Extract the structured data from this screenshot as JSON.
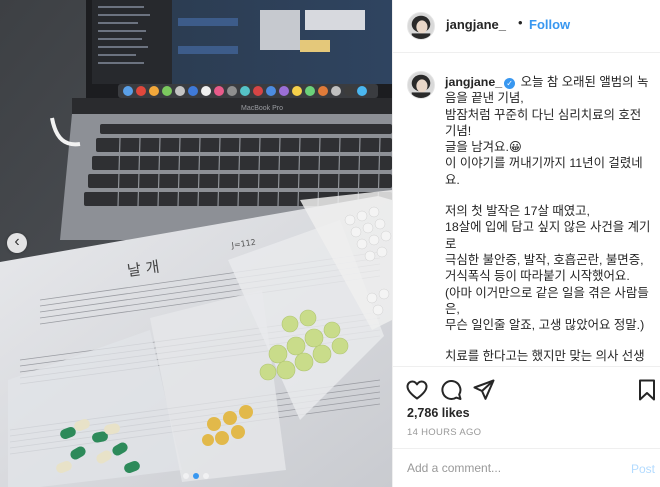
{
  "post": {
    "username": "jangjane_",
    "follow_label": "Follow",
    "separator": "•",
    "verified_icon": "✓"
  },
  "caption": {
    "username": "jangjane_",
    "paragraphs": [
      "오늘 참 오래된 앨범의 녹음을 끝낸 기념,\n밤잠처럼 꾸준히 다닌 심리치료의 호전 기념!\n글을 남겨요.😀\n이 이야기를 꺼내기까지 11년이 걸렸네요.",
      "저의 첫 발작은 17살 때였고,\n18살에 입에 담고 싶지 않은 사건을 계기로\n극심한 불안증, 발작, 호흡곤란, 불면증, 거식폭식 등이 따라붙기 시작했어요.\n(아마 이거만으로 같은 일을 겪은 사람들은,\n무슨 일인줄 알죠, 고생 많았어요 정말.)",
      "치료를 한다고는 했지만 맞는 의사 선생님 찾는 것도 쉬운 일이 아니었고\n그 때 당시엔 병원 가는 걸 큰 흠으로 여"
    ]
  },
  "engagement": {
    "likes": "2,786 likes",
    "timestamp": "14 HOURS AGO"
  },
  "comment_box": {
    "placeholder": "Add a comment...",
    "post_label": "Post"
  },
  "photo": {
    "macbook_label": "MacBook Pro",
    "sheet_title": "날 개",
    "sheet_corner": "J=112",
    "carousel_prev": "‹",
    "carousel_total": 3,
    "carousel_active": 1
  },
  "colors": {
    "link_blue": "#3897f0",
    "post_disabled": "#b3dbff",
    "meta_gray": "#999999",
    "border": "#efefef"
  },
  "icons": [
    "heart-icon",
    "comment-icon",
    "share-icon",
    "bookmark-icon",
    "verified-badge-icon",
    "chevron-left-icon"
  ]
}
